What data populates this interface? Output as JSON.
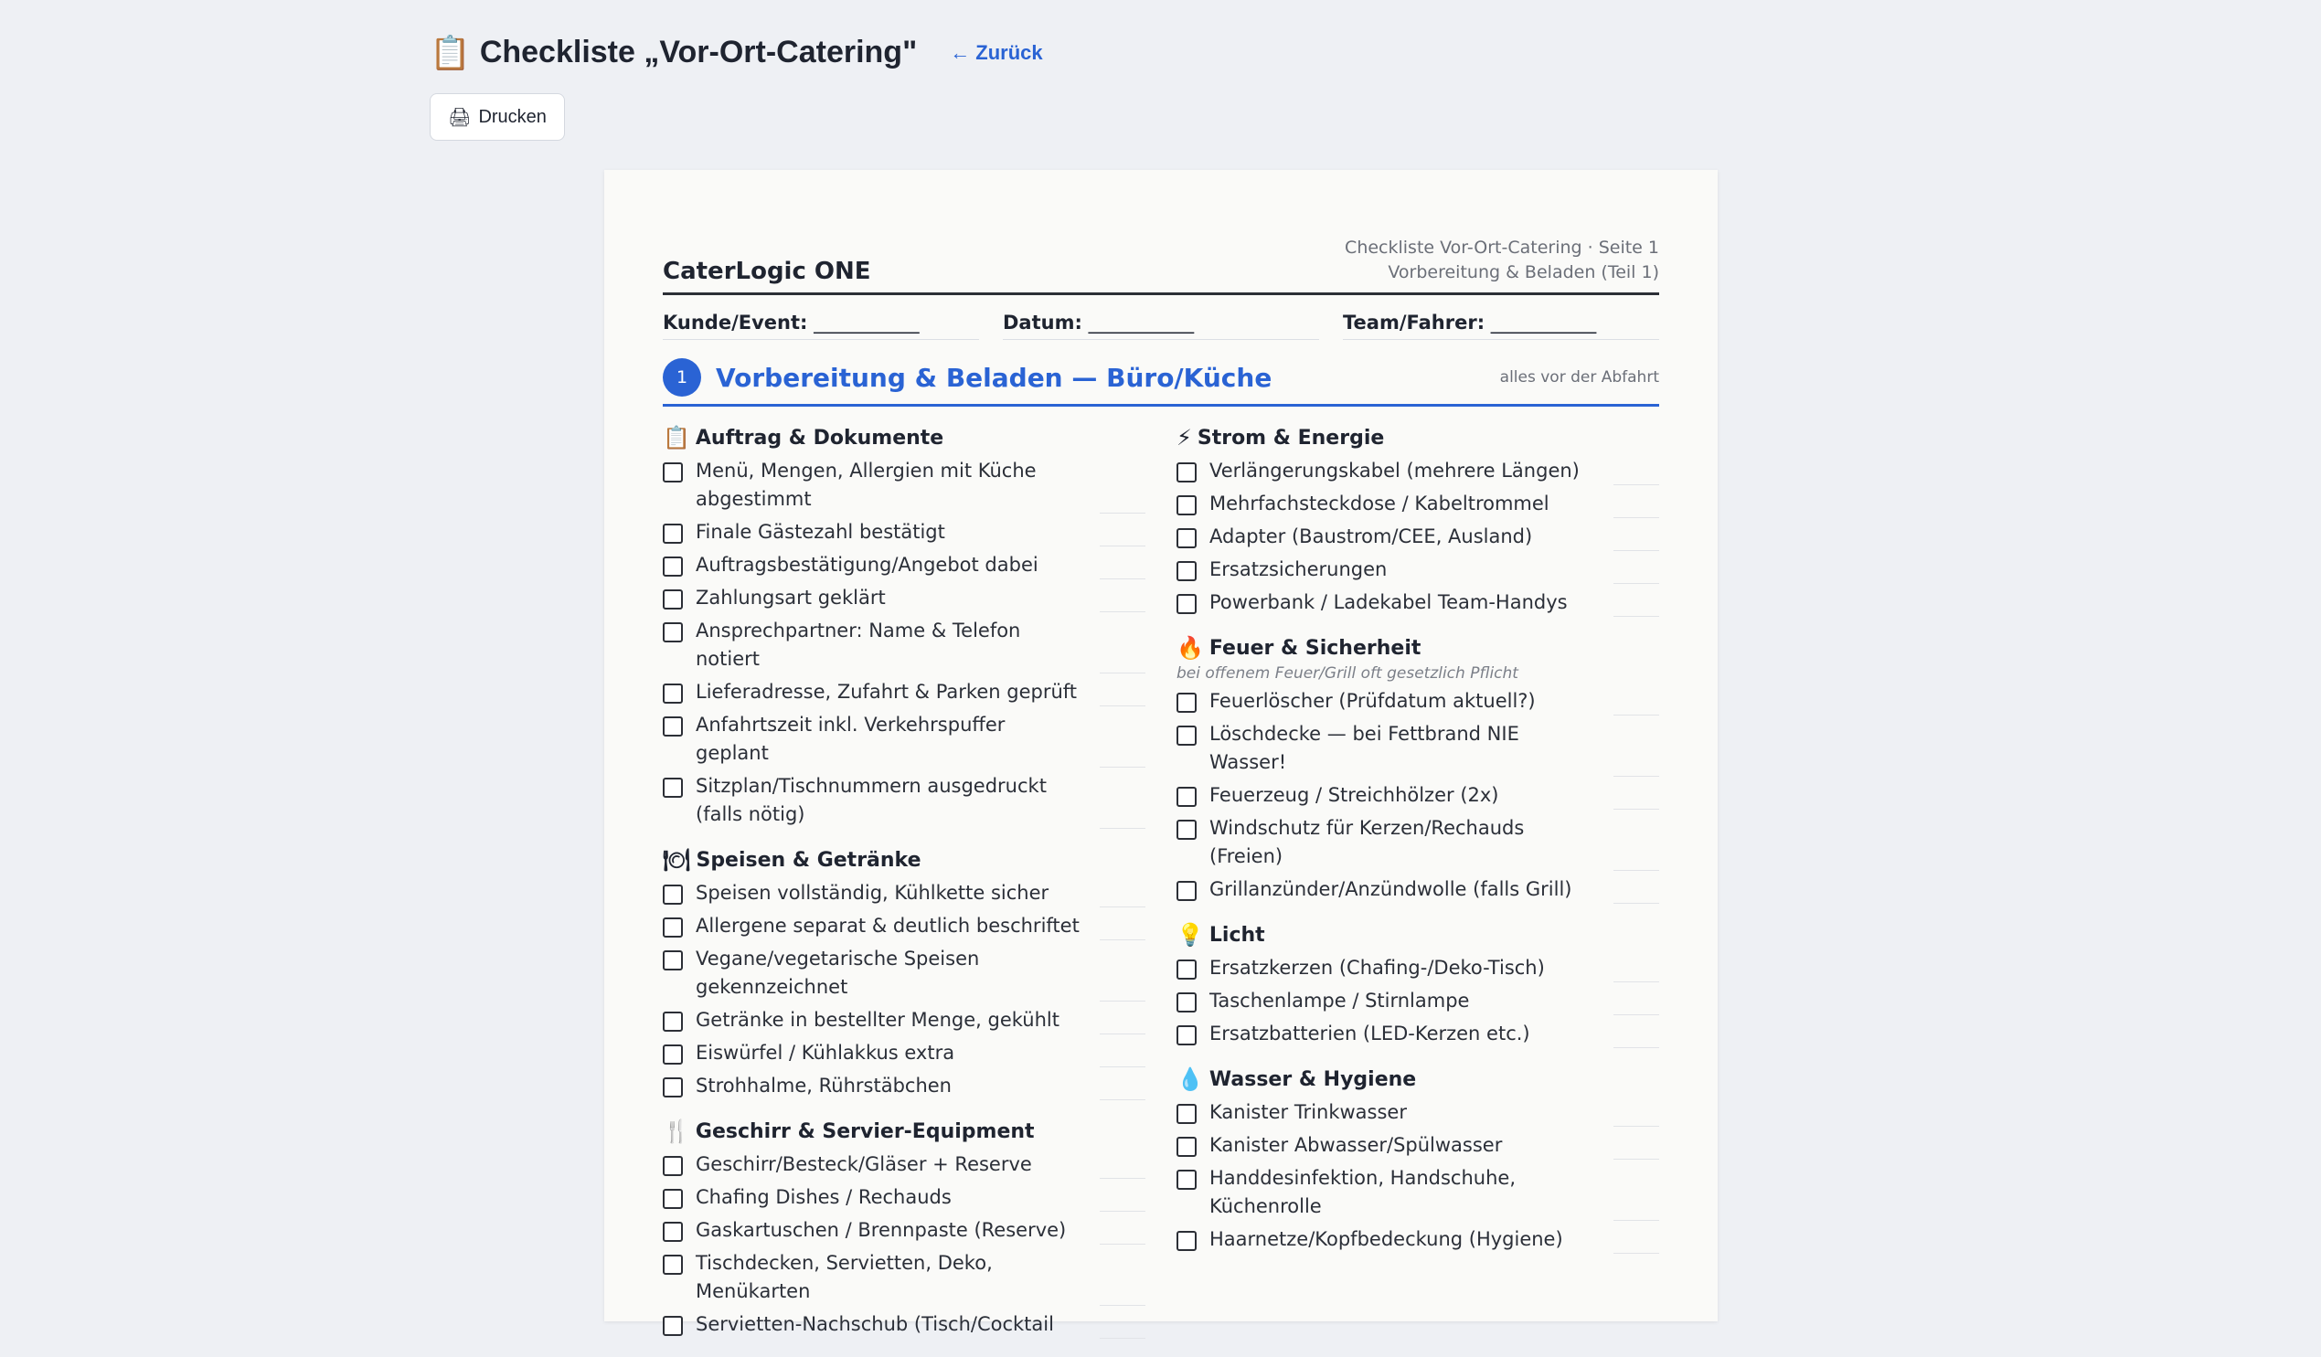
{
  "header": {
    "icon": "clipboard-icon",
    "title": "Checkliste „Vor-Ort-Catering\"",
    "back_label": "← Zurück",
    "print_label": "Drucken",
    "print_icon": "printer-icon"
  },
  "sheet": {
    "brand": "CaterLogic ONE",
    "meta_line1": "Checkliste Vor-Ort-Catering · Seite 1",
    "meta_line2": "Vorbereitung & Beladen (Teil 1)",
    "fields": [
      {
        "label": "Kunde/Event:",
        "blank": "___________"
      },
      {
        "label": "Datum:",
        "blank": "___________"
      },
      {
        "label": "Team/Fahrer:",
        "blank": "___________"
      }
    ],
    "section": {
      "number": "1",
      "title": "Vorbereitung & Beladen — Büro/Küche",
      "note": "alles vor der Abfahrt"
    },
    "left_groups": [
      {
        "icon": "clipboard-icon",
        "glyph": "📋",
        "title": "Auftrag & Dokumente",
        "note": "",
        "items": [
          "Menü, Mengen, Allergien mit Küche abgestimmt",
          "Finale Gästezahl bestätigt",
          "Auftragsbestätigung/Angebot dabei",
          "Zahlungsart geklärt",
          "Ansprechpartner: Name & Telefon notiert",
          "Lieferadresse, Zufahrt & Parken geprüft",
          "Anfahrtszeit inkl. Verkehrspuffer geplant",
          "Sitzplan/Tischnummern ausgedruckt (falls nötig)"
        ]
      },
      {
        "icon": "plate-icon",
        "glyph": "🍽",
        "title": "Speisen & Getränke",
        "note": "",
        "items": [
          "Speisen vollständig, Kühlkette sicher",
          "Allergene separat & deutlich beschriftet",
          "Vegane/vegetarische Speisen gekennzeichnet",
          "Getränke in bestellter Menge, gekühlt",
          "Eiswürfel / Kühlakkus extra",
          "Strohhalme, Rührstäbchen"
        ]
      },
      {
        "icon": "fork-knife-icon",
        "glyph": "🍴",
        "title": "Geschirr & Servier-Equipment",
        "note": "",
        "items": [
          "Geschirr/Besteck/Gläser + Reserve",
          "Chafing Dishes / Rechauds",
          "Gaskartuschen / Brennpaste (Reserve)",
          "Tischdecken, Servietten, Deko, Menükarten",
          "Servietten-Nachschub (Tisch/Cocktail"
        ]
      }
    ],
    "right_groups": [
      {
        "icon": "lightning-icon",
        "glyph": "⚡",
        "title": "Strom & Energie",
        "note": "",
        "items": [
          "Verlängerungskabel (mehrere Längen)",
          "Mehrfachsteckdose / Kabeltrommel",
          "Adapter (Baustrom/CEE, Ausland)",
          "Ersatzsicherungen",
          "Powerbank / Ladekabel Team-Handys"
        ]
      },
      {
        "icon": "fire-icon",
        "glyph": "🔥",
        "title": "Feuer & Sicherheit",
        "note": "bei offenem Feuer/Grill oft gesetzlich Pflicht",
        "items": [
          "Feuerlöscher (Prüfdatum aktuell?)",
          "Löschdecke — bei Fettbrand NIE Wasser!",
          "Feuerzeug / Streichhölzer (2x)",
          "Windschutz für Kerzen/Rechauds (Freien)",
          "Grillanzünder/Anzündwolle (falls Grill)"
        ]
      },
      {
        "icon": "lightbulb-icon",
        "glyph": "💡",
        "title": "Licht",
        "note": "",
        "items": [
          "Ersatzkerzen (Chafing-/Deko-Tisch)",
          "Taschenlampe / Stirnlampe",
          "Ersatzbatterien (LED-Kerzen etc.)"
        ]
      },
      {
        "icon": "droplet-icon",
        "glyph": "💧",
        "title": "Wasser & Hygiene",
        "note": "",
        "items": [
          "Kanister Trinkwasser",
          "Kanister Abwasser/Spülwasser",
          "Handdesinfektion, Handschuhe, Küchenrolle",
          "Haarnetze/Kopfbedeckung (Hygiene)"
        ]
      }
    ]
  }
}
